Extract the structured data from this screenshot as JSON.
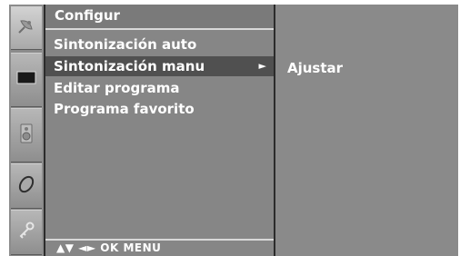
{
  "menu": {
    "title": "Configur",
    "items": [
      {
        "label": "Sintonización auto",
        "selected": false
      },
      {
        "label": "Sintonización manu",
        "selected": true
      },
      {
        "label": "Editar programa",
        "selected": false
      },
      {
        "label": "Programa favorito",
        "selected": false
      }
    ],
    "selected_arrow": "►"
  },
  "submenu": {
    "items": [
      {
        "label": "Ajustar"
      }
    ]
  },
  "footer": {
    "hint": "▲▼ ◄► OK MENU"
  },
  "icons": [
    {
      "name": "satellite-icon",
      "active": true
    },
    {
      "name": "picture-icon",
      "active": false
    },
    {
      "name": "speaker-icon",
      "active": false
    },
    {
      "name": "clock-icon",
      "active": false
    },
    {
      "name": "key-icon",
      "active": false
    }
  ],
  "colors": {
    "panel_bg": "#868686",
    "selected_bg": "#505050",
    "text": "#ffffff"
  }
}
